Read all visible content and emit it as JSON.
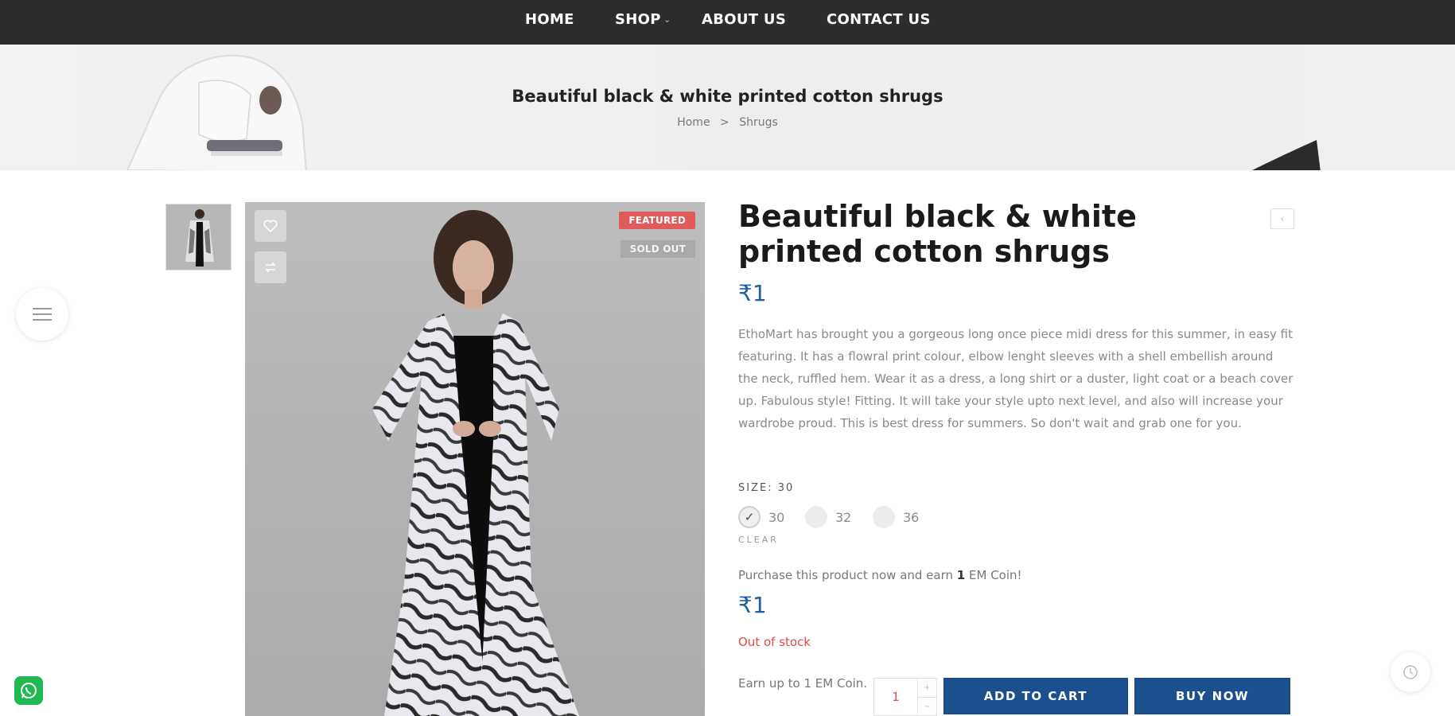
{
  "nav": {
    "items": [
      {
        "label": "HOME"
      },
      {
        "label": "SHOP"
      },
      {
        "label": "ABOUT US"
      },
      {
        "label": "CONTACT US"
      }
    ]
  },
  "banner": {
    "title": "Beautiful black & white printed cotton shrugs",
    "breadcrumb": {
      "home": "Home",
      "sep": ">",
      "current": "Shrugs"
    }
  },
  "product": {
    "title": "Beautiful black & white printed cotton shrugs",
    "price": "₹1",
    "badges": {
      "featured": "FEATURED",
      "sold_out": "SOLD OUT"
    },
    "description": "EthoMart has brought you a gorgeous long once piece midi dress for this summer, in easy fit featuring. It has a flowral print colour, elbow lenght sleeves with a shell embellish around the neck, ruffled hem. Wear it as a dress, a long shirt or a duster, light coat or a beach cover up. Fabulous style! Fitting. It will take your style upto next level, and also will increase your wardrobe proud. This is best dress for summers. So don't wait and grab one for you.",
    "size_label": "SIZE: 30",
    "sizes": [
      {
        "label": "30",
        "selected": true
      },
      {
        "label": "32",
        "selected": false
      },
      {
        "label": "36",
        "selected": false
      }
    ],
    "clear_label": "CLEAR",
    "earn_text_prefix": "Purchase this product now and earn ",
    "earn_amount": "1",
    "earn_text_suffix": " EM Coin!",
    "variant_price": "₹1",
    "stock_status": "Out of stock",
    "earn_up_to": "Earn up to 1 EM Coin.",
    "quantity": "1",
    "add_to_cart": "ADD TO CART",
    "buy_now": "BUY NOW"
  },
  "colors": {
    "nav_bg": "#2d2d2d",
    "price": "#1d5fa0",
    "primary_button": "#1b4f8d",
    "out_of_stock": "#e04a4a",
    "featured_badge": "#e05a5a",
    "whatsapp": "#1fb851"
  },
  "icons": {
    "wishlist": "heart-icon",
    "compare": "compare-icon",
    "menu": "hamburger-icon",
    "prev": "chevron-left-icon",
    "check": "check-icon",
    "whatsapp": "whatsapp-icon",
    "history": "history-icon"
  }
}
